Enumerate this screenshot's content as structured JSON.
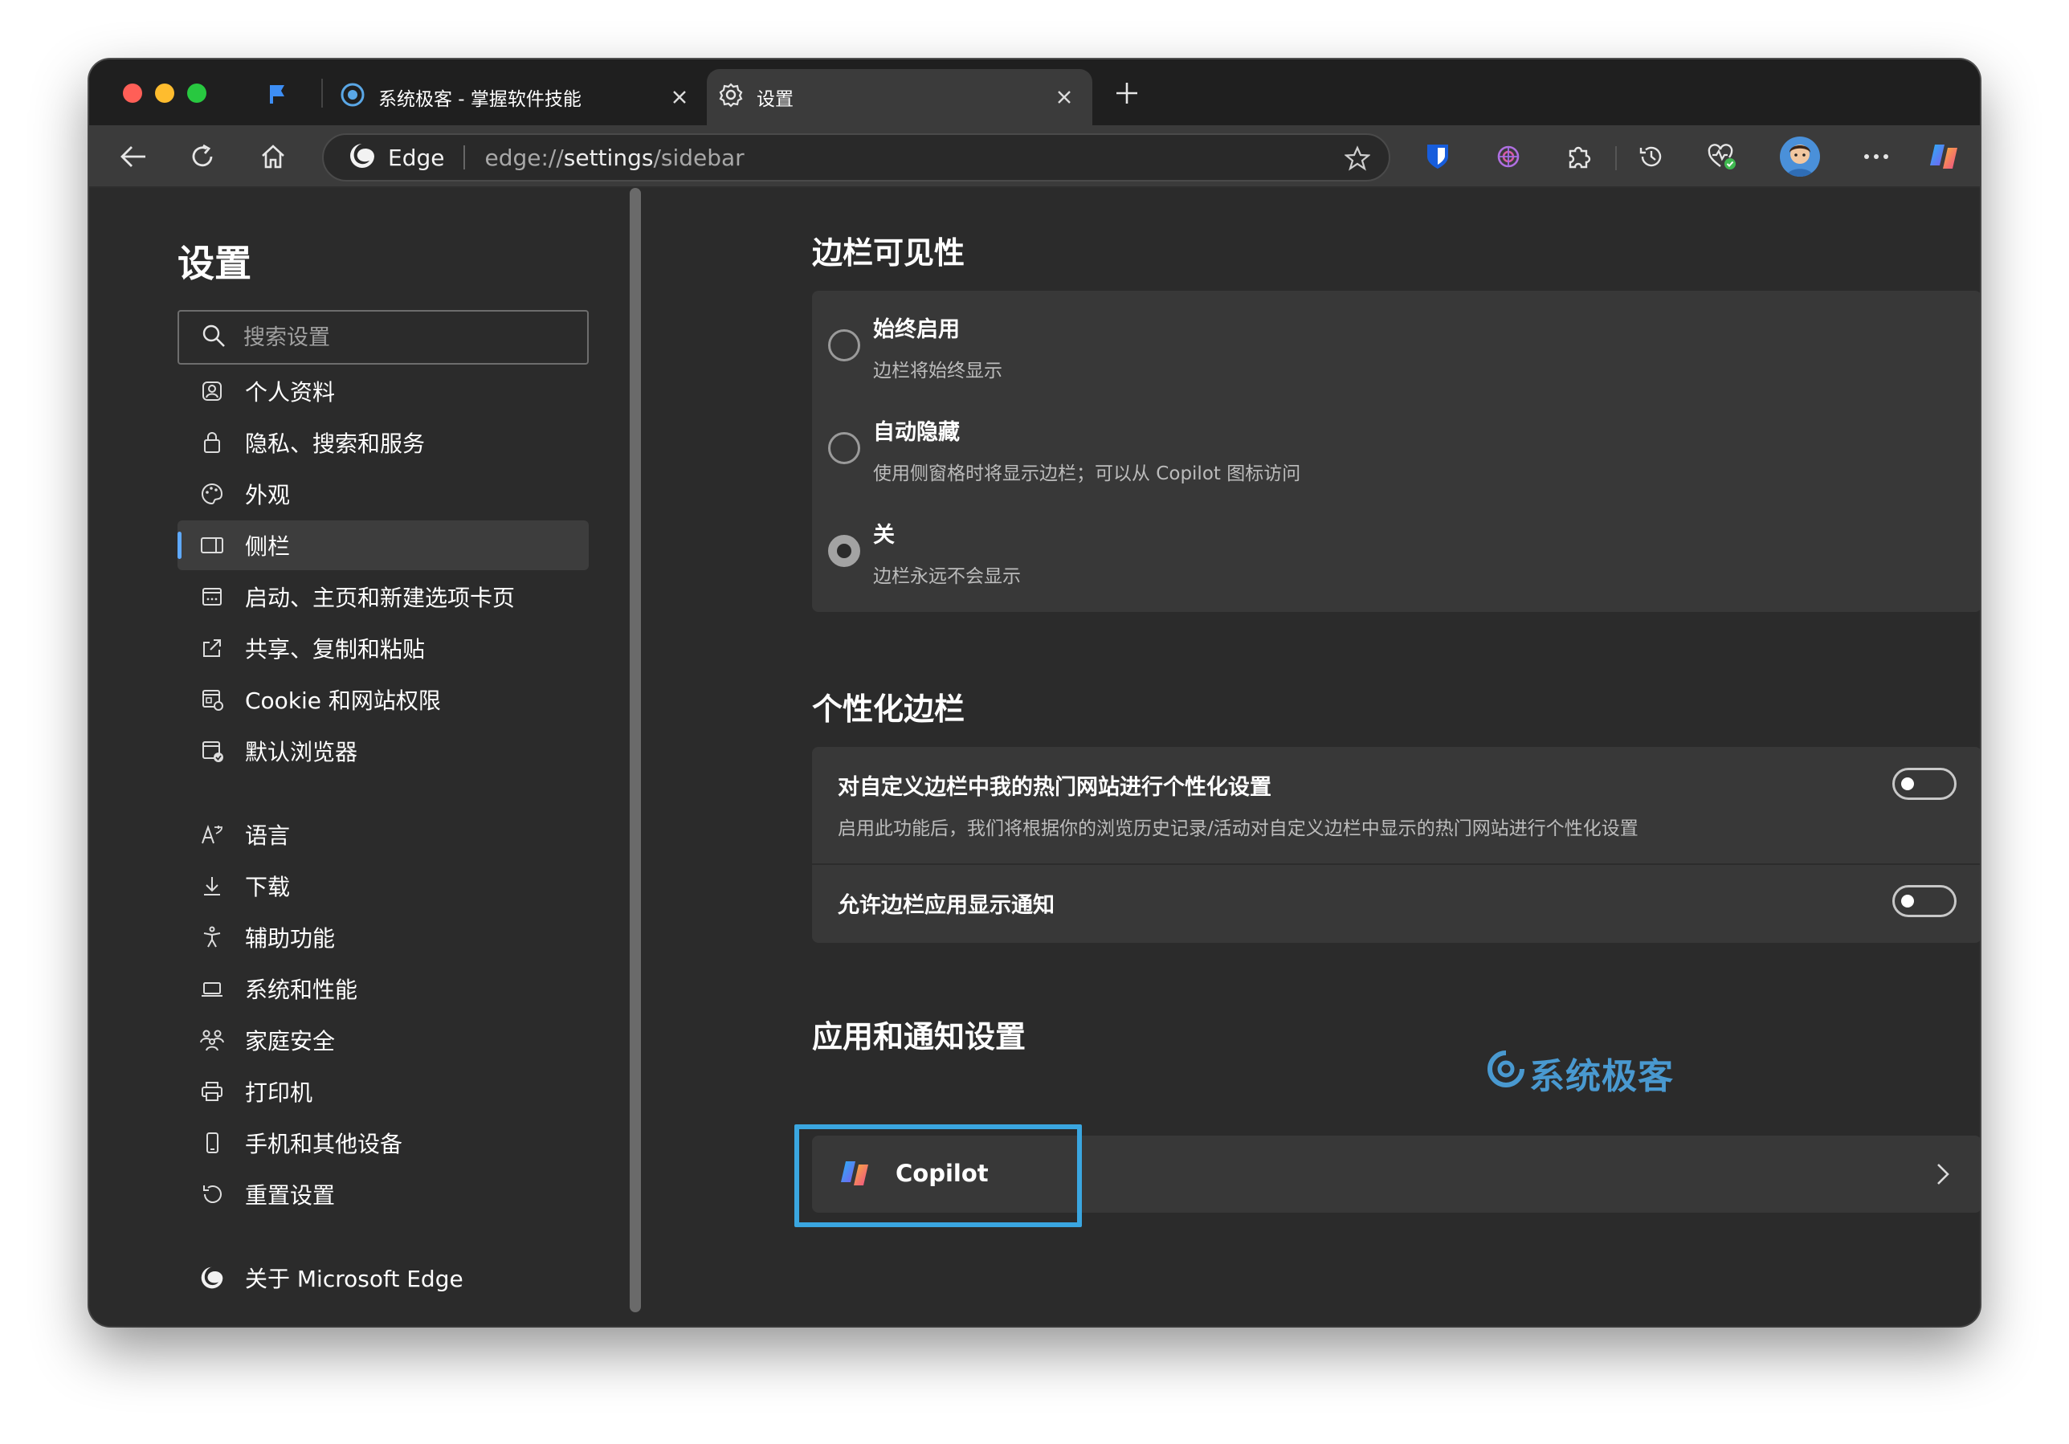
{
  "tabs": [
    {
      "label": "系统极客 - 掌握软件技能"
    },
    {
      "label": "设置"
    }
  ],
  "address": {
    "brand": "Edge",
    "url_prefix": "edge://",
    "url_highlight": "settings",
    "url_suffix": "/sidebar"
  },
  "nav": {
    "title": "设置",
    "search_placeholder": "搜索设置",
    "items": [
      {
        "label": "个人资料",
        "icon": "profile-icon"
      },
      {
        "label": "隐私、搜索和服务",
        "icon": "lock-icon"
      },
      {
        "label": "外观",
        "icon": "palette-icon"
      },
      {
        "label": "侧栏",
        "icon": "sidebar-icon",
        "active": true
      },
      {
        "label": "启动、主页和新建选项卡页",
        "icon": "home-page-icon"
      },
      {
        "label": "共享、复制和粘贴",
        "icon": "share-icon"
      },
      {
        "label": "Cookie 和网站权限",
        "icon": "cookie-icon"
      },
      {
        "label": "默认浏览器",
        "icon": "default-browser-icon"
      },
      {
        "label": "语言",
        "icon": "language-icon"
      },
      {
        "label": "下载",
        "icon": "download-icon"
      },
      {
        "label": "辅助功能",
        "icon": "accessibility-icon"
      },
      {
        "label": "系统和性能",
        "icon": "laptop-icon"
      },
      {
        "label": "家庭安全",
        "icon": "family-icon"
      },
      {
        "label": "打印机",
        "icon": "printer-icon"
      },
      {
        "label": "手机和其他设备",
        "icon": "phone-icon"
      },
      {
        "label": "重置设置",
        "icon": "reset-icon"
      },
      {
        "label": "关于 Microsoft Edge",
        "icon": "edge-logo-icon"
      }
    ]
  },
  "visibility": {
    "title": "边栏可见性",
    "options": [
      {
        "label": "始终启用",
        "desc": "边栏将始终显示",
        "checked": false
      },
      {
        "label": "自动隐藏",
        "desc": "使用侧窗格时将显示边栏；可以从 Copilot 图标访问",
        "checked": false
      },
      {
        "label": "关",
        "desc": "边栏永远不会显示",
        "checked": true
      }
    ]
  },
  "personalize": {
    "title": "个性化边栏",
    "rows": [
      {
        "label": "对自定义边栏中我的热门网站进行个性化设置",
        "desc": "启用此功能后，我们将根据你的浏览历史记录/活动对自定义边栏中显示的热门网站进行个性化设置",
        "enabled": false
      },
      {
        "label": "允许边栏应用显示通知",
        "enabled": false
      }
    ]
  },
  "apps": {
    "title": "应用和通知设置",
    "copilot_label": "Copilot"
  },
  "watermark": "系统极客",
  "colors": {
    "accent": "#5ea9ff",
    "highlight": "#3aa6e0"
  }
}
